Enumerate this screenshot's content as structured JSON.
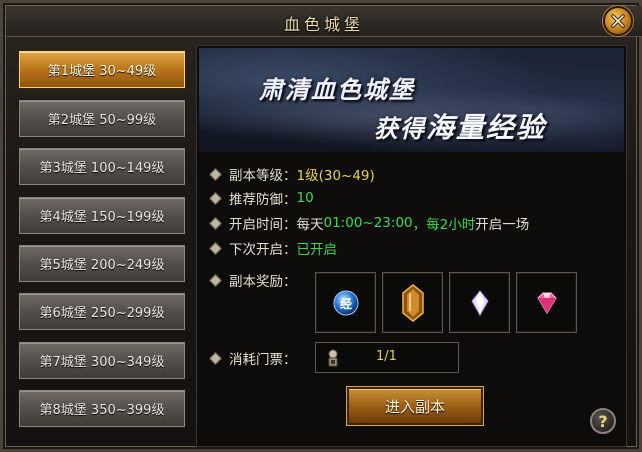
{
  "window": {
    "title": "血色城堡"
  },
  "icons": {
    "close": "close-icon",
    "help": "help-icon",
    "exp_orb": "exp-orb-icon",
    "amber_crystal": "amber-crystal-icon",
    "white_gem": "white-gem-icon",
    "pink_gem": "pink-gem-icon",
    "ticket": "ticket-icon"
  },
  "tiers": [
    {
      "label": "第1城堡 30~49级",
      "active": true
    },
    {
      "label": "第2城堡 50~99级",
      "active": false
    },
    {
      "label": "第3城堡 100~149级",
      "active": false
    },
    {
      "label": "第4城堡 150~199级",
      "active": false
    },
    {
      "label": "第5城堡 200~249级",
      "active": false
    },
    {
      "label": "第6城堡 250~299级",
      "active": false
    },
    {
      "label": "第7城堡 300~349级",
      "active": false
    },
    {
      "label": "第8城堡 350~399级",
      "active": false
    }
  ],
  "banner": {
    "line1": "肃清血色城堡",
    "line2_a": "获得",
    "line2_b": "海量经验"
  },
  "info": {
    "level_label": "副本等级：",
    "level_value": "1级(30~49)",
    "defense_label": "推荐防御：",
    "defense_value": "10",
    "time_label": "开启时间：",
    "time_prefix": "每天",
    "time_range": "01:00~23:00",
    "time_sep": "，",
    "time_interval": "每2小时",
    "time_suffix": "开启一场",
    "next_label": "下次开启：",
    "next_value": "已开启",
    "reward_label": "副本奖励：",
    "ticket_label": "消耗门票：",
    "ticket_count": "1/1",
    "exp_orb_char": "经"
  },
  "buttons": {
    "enter": "进入副本",
    "help": "?"
  },
  "colors": {
    "accent": "#c98f35",
    "highlight_yellow": "#e6d24a",
    "highlight_green": "#39d94a"
  }
}
